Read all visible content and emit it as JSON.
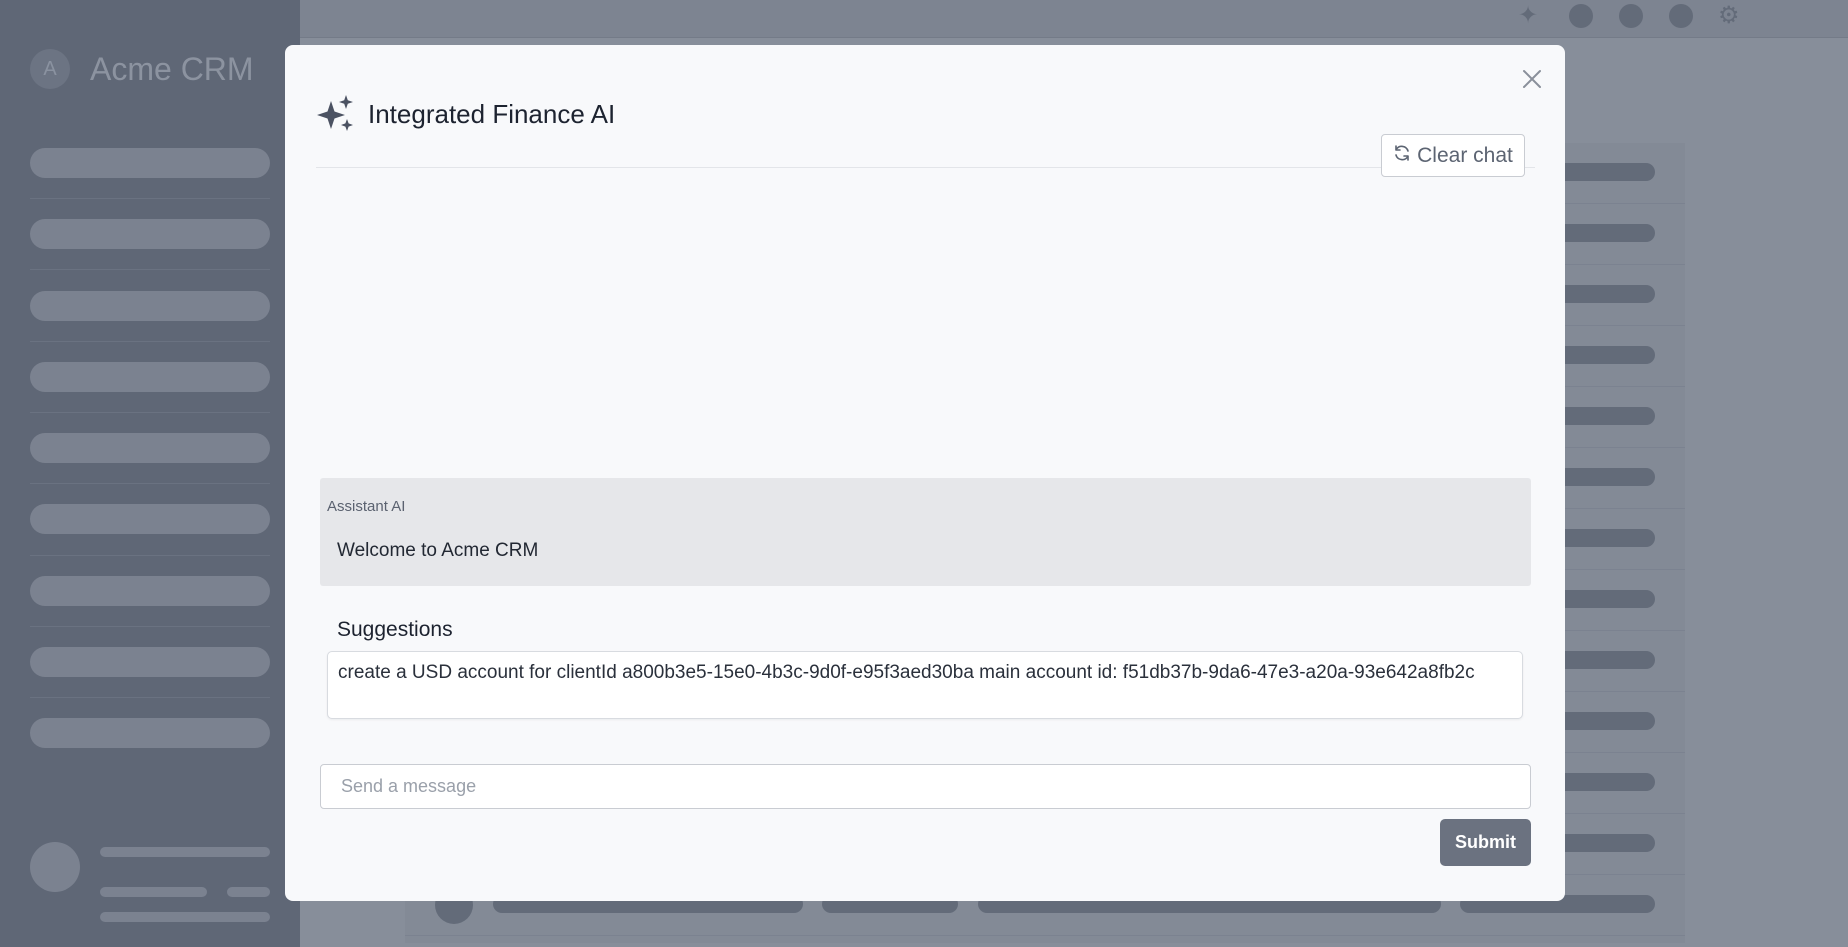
{
  "app": {
    "brand_initial": "A",
    "brand_name": "Acme CRM"
  },
  "modal": {
    "title": "Integrated Finance AI",
    "clear_chat_label": "Clear chat",
    "assistant": {
      "label": "Assistant AI",
      "message": "Welcome to Acme CRM"
    },
    "suggestions": {
      "title": "Suggestions",
      "items": [
        "create a USD account for clientId a800b3e5-15e0-4b3c-9d0f-e95f3aed30ba main account id: f51db37b-9da6-47e3-a20a-93e642a8fb2c"
      ]
    },
    "input": {
      "placeholder": "Send a message",
      "value": ""
    },
    "submit_label": "Submit"
  },
  "icons": {
    "header_icon": "sparkles-icon",
    "close": "close-icon",
    "clear": "refresh-icon"
  },
  "colors": {
    "overlay": "#878e9a",
    "modal_bg": "#f8f9fb",
    "submit_bg": "#6b7280",
    "assistant_bg": "#e6e7ea"
  }
}
